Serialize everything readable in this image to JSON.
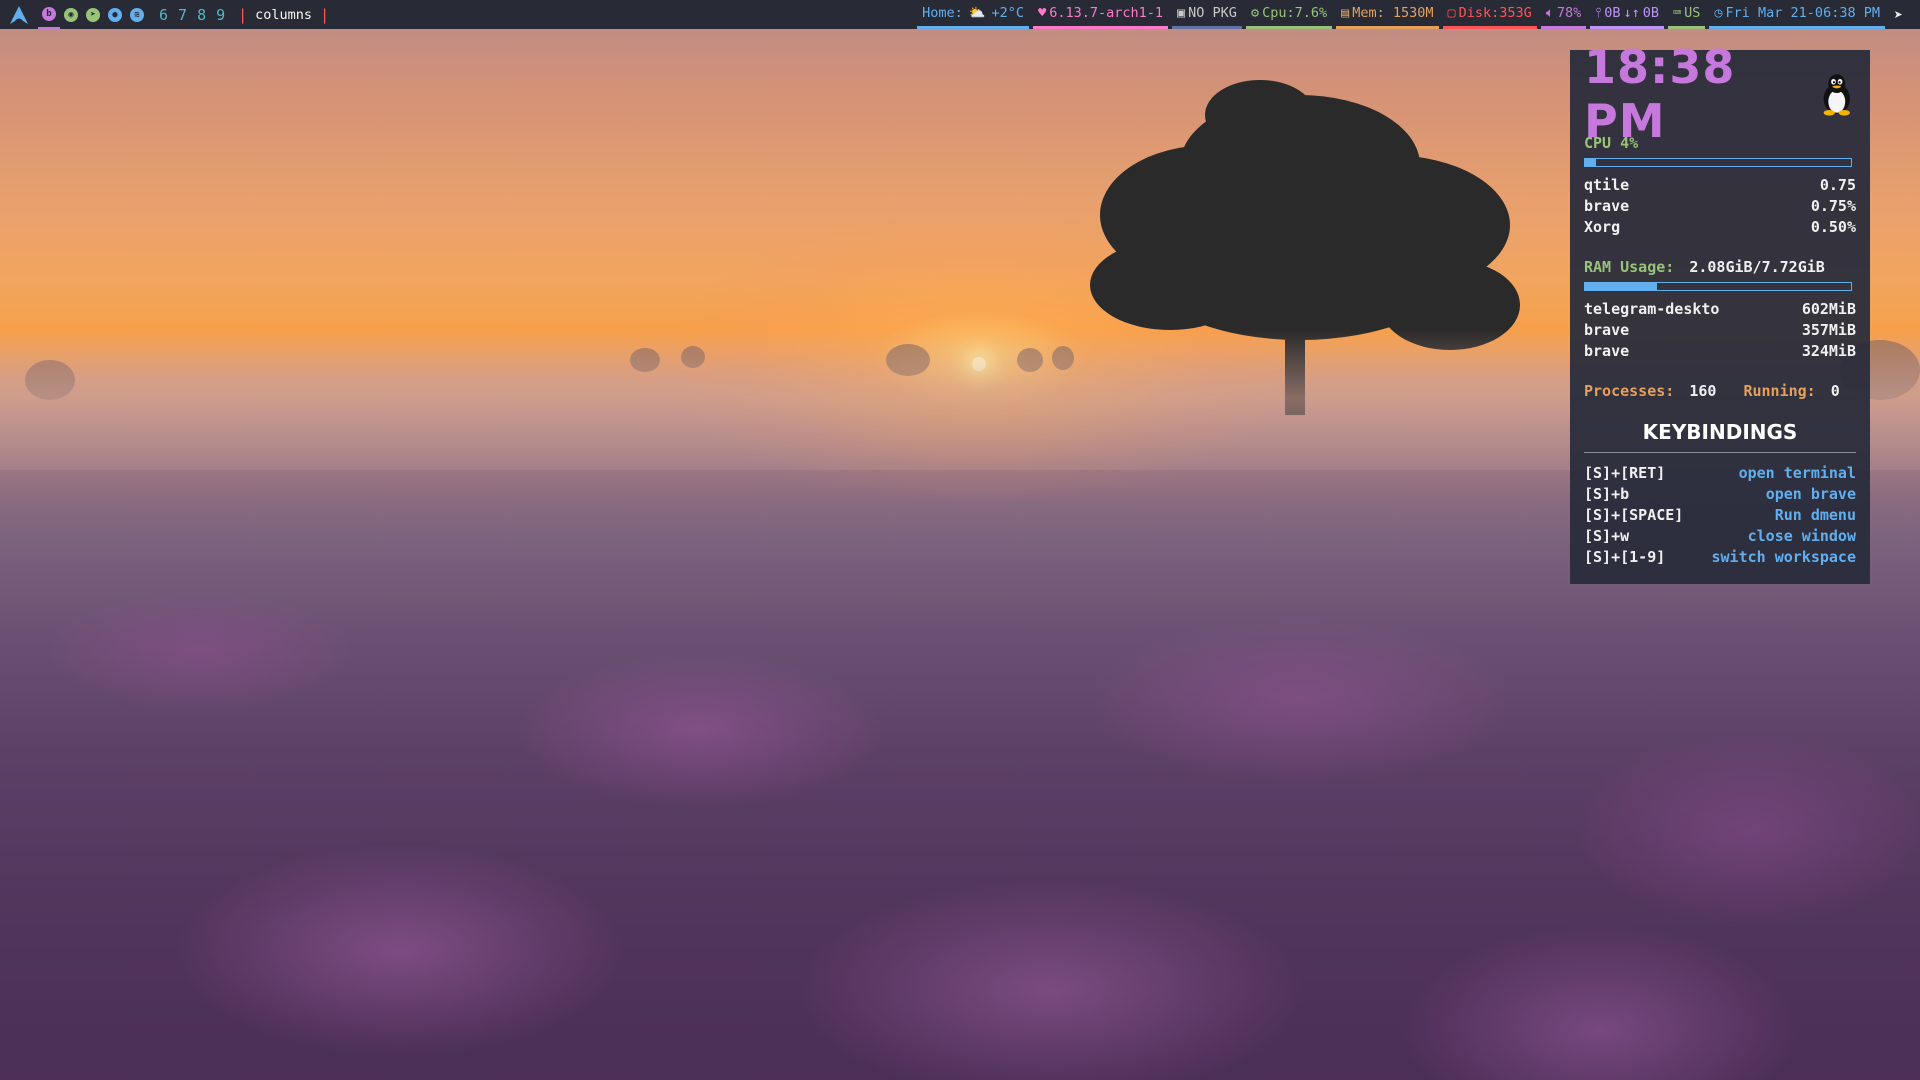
{
  "bar": {
    "workspaces_icons": [
      {
        "name": "brave",
        "color": "#c678dd",
        "glyph": "b",
        "active": true
      },
      {
        "name": "globe",
        "color": "#98c379",
        "glyph": "◉",
        "active": false
      },
      {
        "name": "telegram",
        "color": "#98c379",
        "glyph": "➤",
        "active": false
      },
      {
        "name": "steam",
        "color": "#61afef",
        "glyph": "●",
        "active": false
      },
      {
        "name": "spotify",
        "color": "#61afef",
        "glyph": "≋",
        "active": false
      }
    ],
    "workspace_numbers": [
      "6",
      "7",
      "8",
      "9"
    ],
    "layout": "columns",
    "weather_label": "Home:",
    "weather_value": "+2°C",
    "kernel": "6.13.7-arch1-1",
    "packages": "NO PKG",
    "cpu": "Cpu:7.6%",
    "mem": "Mem: 1530M",
    "disk": "Disk:353G",
    "volume": "78%",
    "net_up": "0B",
    "net_down": "0B",
    "keyboard": "US",
    "datetime": "Fri Mar 21-06:38 PM"
  },
  "panel": {
    "time": "18:38 PM",
    "cpu_label": "CPU 4%",
    "cpu_fill": 0.04,
    "cpu_processes": [
      {
        "name": "qtile",
        "value": "0.75"
      },
      {
        "name": "brave",
        "value": "0.75%"
      },
      {
        "name": "Xorg",
        "value": "0.50%"
      }
    ],
    "ram_label": "RAM Usage:",
    "ram_value": "2.08GiB/7.72GiB",
    "ram_fill": 0.27,
    "ram_processes": [
      {
        "name": "telegram-deskto",
        "value": "602MiB"
      },
      {
        "name": "brave",
        "value": "357MiB"
      },
      {
        "name": "brave",
        "value": "324MiB"
      }
    ],
    "processes_label": "Processes:",
    "processes_value": "160",
    "running_label": "Running:",
    "running_value": "0",
    "keybindings_title": "KEYBINDINGS",
    "keybindings": [
      {
        "key": "[S]+[RET]",
        "action": "open terminal"
      },
      {
        "key": "[S]+b",
        "action": "open brave"
      },
      {
        "key": "[S]+[SPACE]",
        "action": "Run dmenu"
      },
      {
        "key": "[S]+w",
        "action": "close window"
      },
      {
        "key": "[S]+[1-9]",
        "action": "switch workspace"
      }
    ]
  },
  "colors": {
    "bar_bg": "#282a36",
    "accent_purple": "#c678dd",
    "accent_blue": "#61afef",
    "accent_green": "#98c379",
    "accent_orange": "#e5a05c",
    "accent_red": "#ff5555",
    "accent_pink": "#ff79c6"
  }
}
